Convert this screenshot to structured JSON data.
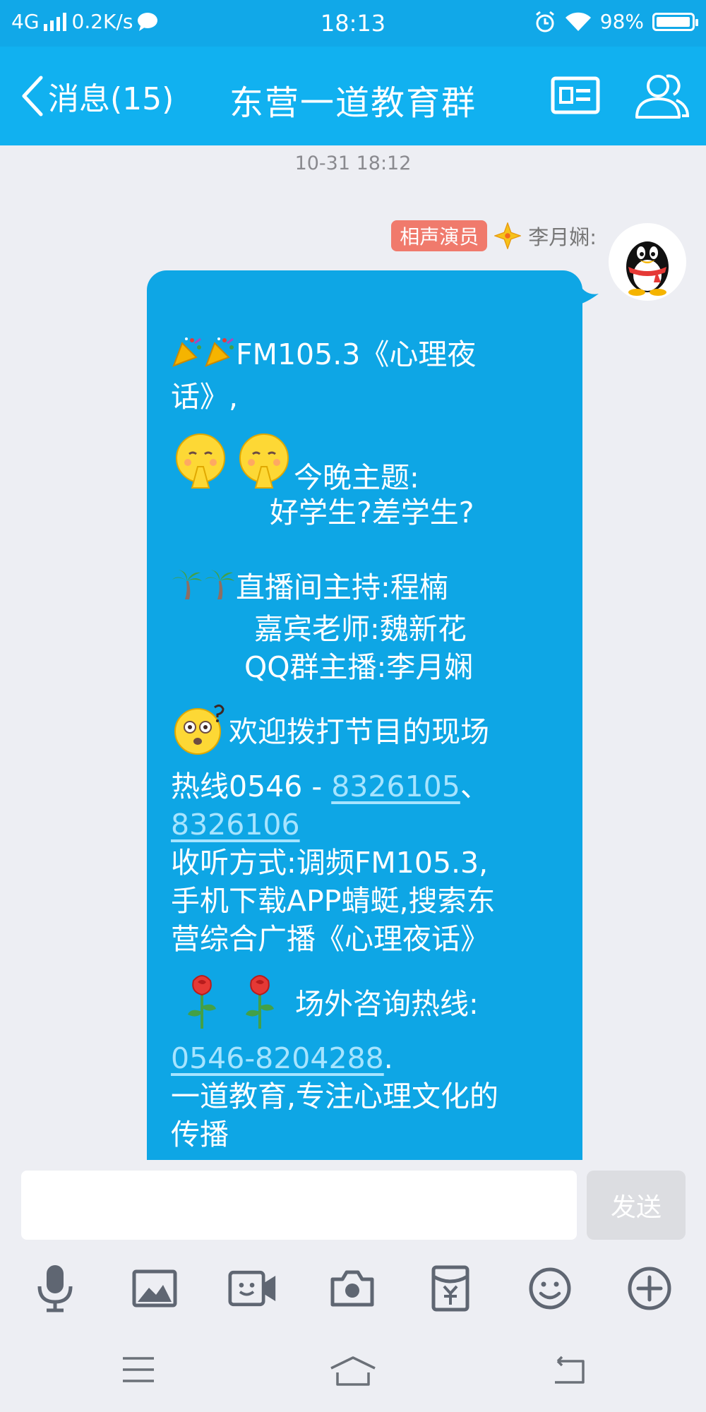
{
  "status_bar": {
    "network": "4G",
    "speed": "0.2K/s",
    "time": "18:13",
    "battery": "98%",
    "battery_level": 0.98
  },
  "header": {
    "back_label": "消息(15)",
    "title": "东营一道教育群"
  },
  "chat": {
    "timestamp": "10-31 18:12",
    "sender_badge": "相声演员",
    "sender_name": "李月娴:",
    "message": {
      "l1": "FM105.3《心理夜",
      "l2": "话》,",
      "l3": "今晚主题:",
      "l4": "好学生?差学生?",
      "l5": "直播间主持:程楠",
      "l6": "嘉宾老师:魏新花",
      "l7": "QQ群主播:李月娴",
      "l8": "欢迎拨打节目的现场",
      "l9_prefix": "热线0546 - ",
      "l9_link": "8326105",
      "l9_suffix": "、",
      "l10_link": "8326106",
      "l11": "收听方式:调频FM105.3,",
      "l12": "手机下载APP蜻蜓,搜索东",
      "l13": "营综合广播《心理夜话》",
      "l14": "场外咨询热线:",
      "l15_link": "0546-8204288",
      "l15_suffix": ".",
      "l16": "一道教育,专注心理文化的",
      "l17": "传播"
    }
  },
  "input": {
    "placeholder": "",
    "send_label": "发送"
  },
  "toolbar_icons": [
    "microphone-icon",
    "image-icon",
    "video-icon",
    "camera-icon",
    "red-packet-icon",
    "emoji-icon",
    "plus-icon"
  ],
  "colors": {
    "header_bg": "#11b1f0",
    "bubble_bg": "#0ea6e5",
    "badge_bg": "#f07a6c",
    "link": "#a6e4ff"
  }
}
